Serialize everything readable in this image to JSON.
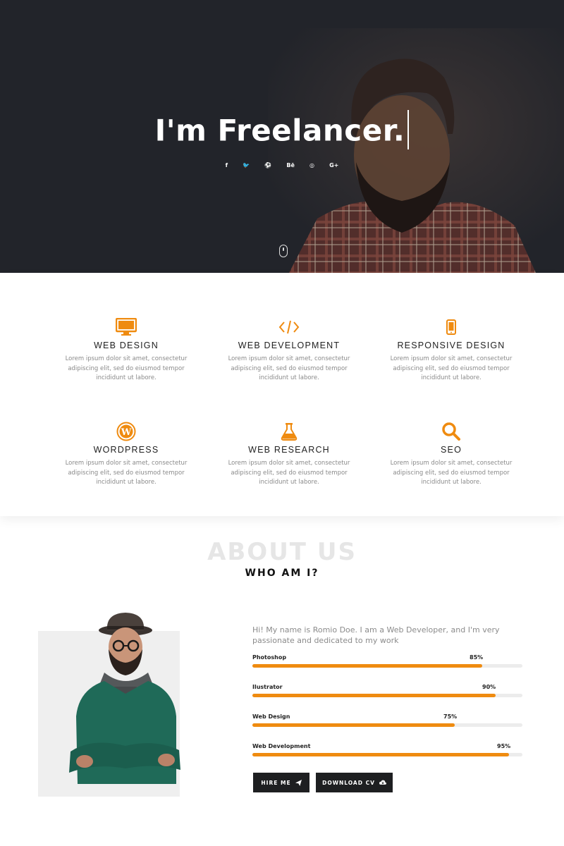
{
  "hero": {
    "title": "I'm Freelancer.",
    "social": [
      {
        "icon": "facebook-icon",
        "glyph": "f"
      },
      {
        "icon": "twitter-icon",
        "glyph": "🐦"
      },
      {
        "icon": "dribbble-icon",
        "glyph": "⚽"
      },
      {
        "icon": "behance-icon",
        "glyph": "Bē"
      },
      {
        "icon": "github-icon",
        "glyph": "◎"
      },
      {
        "icon": "google-plus-icon",
        "glyph": "G+"
      }
    ]
  },
  "services": [
    {
      "icon": "monitor-icon",
      "title": "WEB DESIGN",
      "desc": "Lorem ipsum dolor sit amet, consectetur adipiscing elit, sed do eiusmod tempor incididunt ut labore."
    },
    {
      "icon": "code-icon",
      "title": "WEB DEVELOPMENT",
      "desc": "Lorem ipsum dolor sit amet, consectetur adipiscing elit, sed do eiusmod tempor incididunt ut labore."
    },
    {
      "icon": "mobile-icon",
      "title": "RESPONSIVE DESIGN",
      "desc": "Lorem ipsum dolor sit amet, consectetur adipiscing elit, sed do eiusmod tempor incididunt ut labore."
    },
    {
      "icon": "wordpress-icon",
      "title": "WORDPRESS",
      "desc": "Lorem ipsum dolor sit amet, consectetur adipiscing elit, sed do eiusmod tempor incididunt ut labore."
    },
    {
      "icon": "flask-icon",
      "title": "WEB RESEARCH",
      "desc": "Lorem ipsum dolor sit amet, consectetur adipiscing elit, sed do eiusmod tempor incididunt ut labore."
    },
    {
      "icon": "search-icon",
      "title": "SEO",
      "desc": "Lorem ipsum dolor sit amet, consectetur adipiscing elit, sed do eiusmod tempor incididunt ut labore."
    }
  ],
  "about": {
    "bg_title": "ABOUT US",
    "subtitle": "WHO AM I?",
    "intro": "Hi! My name is Romio Doe. I am a Web Developer, and I'm very passionate and dedicated to my work",
    "skills": [
      {
        "name": "Photoshop",
        "pct_label": "85%",
        "value": 0.85
      },
      {
        "name": "Ilustrator",
        "pct_label": "90%",
        "value": 0.9
      },
      {
        "name": "Web Design",
        "pct_label": "75%",
        "value": 0.75
      },
      {
        "name": "Web Development",
        "pct_label": "95%",
        "value": 0.95
      }
    ],
    "hire_label": "HIRE ME",
    "download_label": "DOWNLOAD CV"
  },
  "colors": {
    "accent": "#ef8b10",
    "dark": "#1e1f21"
  }
}
